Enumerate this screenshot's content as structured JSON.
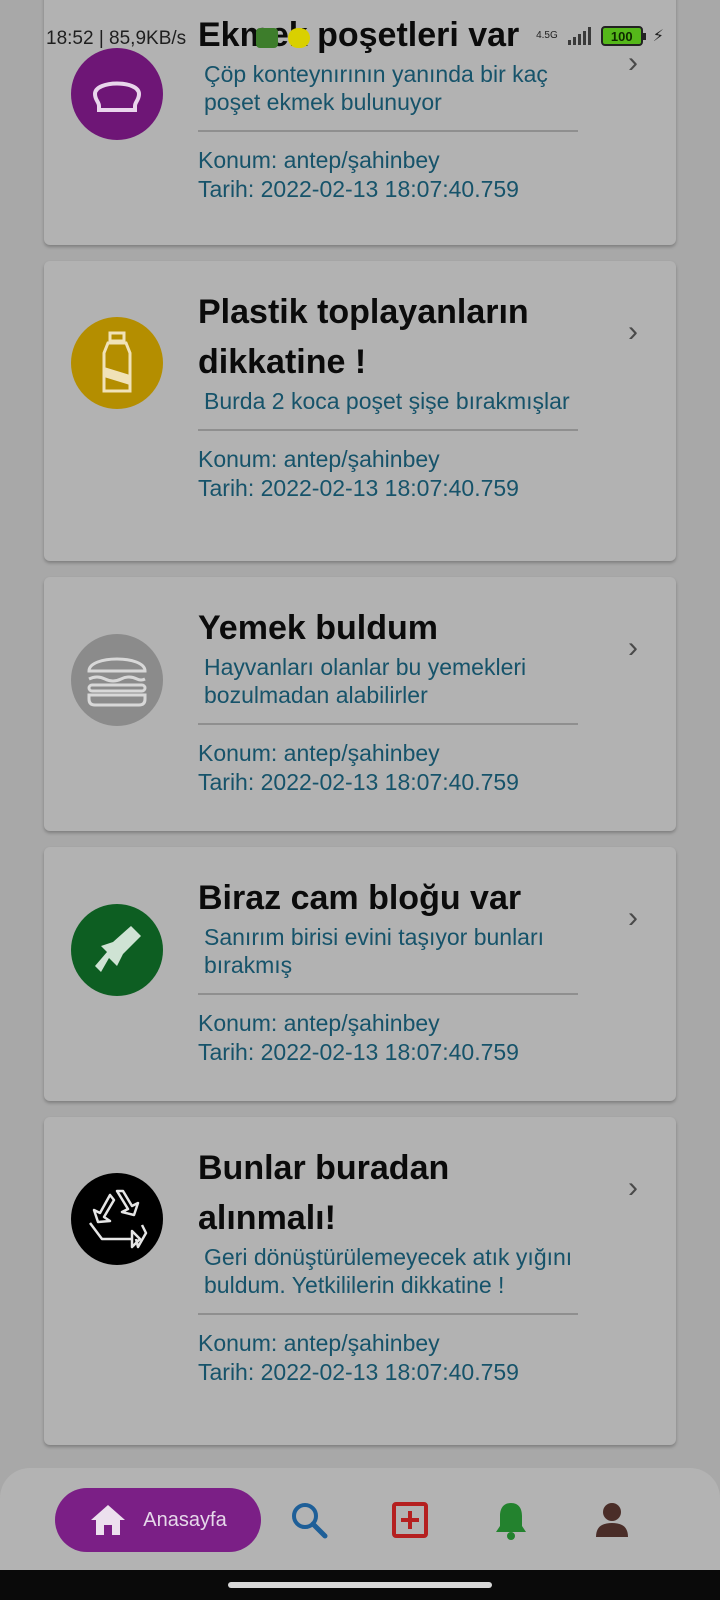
{
  "status_bar": {
    "time_speed": "18:52 | 85,9KB/s",
    "network_type": "4.5G",
    "battery_level": "100"
  },
  "posts": [
    {
      "title": "Ekmek poşetleri var",
      "description": "Çöp konteynırının yanında bir kaç poşet ekmek bulunuyor",
      "location": "Konum: antep/şahinbey",
      "date": "Tarih: 2022-02-13 18:07:40.759",
      "icon": "bread-icon",
      "icon_color": "#6e1676"
    },
    {
      "title": "Plastik toplayanların dikkatine !",
      "description": "Burda 2 koca poşet şişe bırakmışlar",
      "location": "Konum: antep/şahinbey",
      "date": "Tarih: 2022-02-13 18:07:40.759",
      "icon": "plastic-bottle-icon",
      "icon_color": "#b48e00"
    },
    {
      "title": "Yemek buldum",
      "description": "Hayvanları olanlar bu yemekleri bozulmadan alabilirler",
      "location": "Konum: antep/şahinbey",
      "date": "Tarih: 2022-02-13 18:07:40.759",
      "icon": "burger-icon",
      "icon_color": "#8b8b8b"
    },
    {
      "title": "Biraz cam bloğu var",
      "description": "Sanırım birisi evini taşıyor bunları bırakmış",
      "location": "Konum: antep/şahinbey",
      "date": "Tarih: 2022-02-13 18:07:40.759",
      "icon": "broken-glass-icon",
      "icon_color": "#0d5e22"
    },
    {
      "title": "Bunlar buradan alınmalı!",
      "description": "Geri dönüştürülemeyecek atık yığını buldum. Yetkililerin dikkatine !",
      "location": "Konum: antep/şahinbey",
      "date": "Tarih: 2022-02-13 18:07:40.759",
      "icon": "recycle-icon",
      "icon_color": "#000000"
    }
  ],
  "bottom_nav": {
    "home_label": "Anasayfa",
    "items": [
      "home-icon",
      "search-icon",
      "add-icon",
      "notifications-icon",
      "profile-icon"
    ],
    "colors": {
      "home_active": "#7b1f86",
      "search": "#1e5f98",
      "add": "#b52020",
      "notifications": "#23822e",
      "profile": "#4a2d28"
    }
  }
}
